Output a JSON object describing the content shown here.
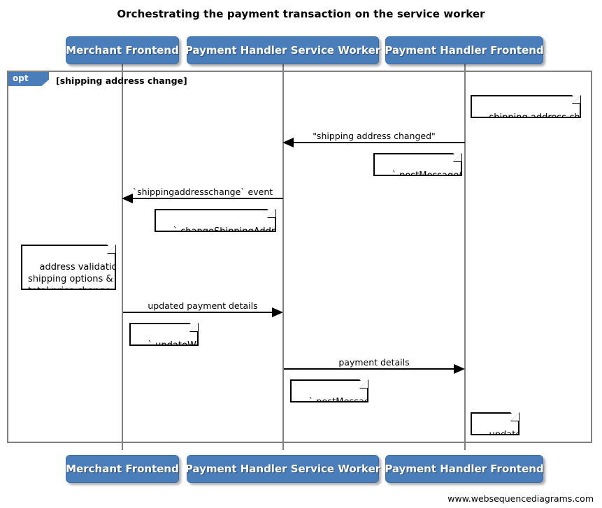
{
  "diagram": {
    "title": "Orchestrating the payment transaction on the service worker",
    "footer": "www.websequencediagrams.com",
    "colors": {
      "participant_fill": "#4a7ebb",
      "participant_text": "#ffffff",
      "lifeline": "#808080",
      "frame_border": "#808080",
      "note_border": "#000000",
      "note_fill": "#ffffff",
      "arrow": "#000000"
    }
  },
  "participants": [
    {
      "id": "merchant-frontend",
      "label": "Merchant Frontend"
    },
    {
      "id": "payment-handler-service-worker",
      "label": "Payment Handler Service Worker"
    },
    {
      "id": "payment-handler-frontend",
      "label": "Payment Handler Frontend"
    }
  ],
  "participants_bottom": [
    {
      "id": "merchant-frontend",
      "label": "Merchant Frontend"
    },
    {
      "id": "payment-handler-service-worker",
      "label": "Payment Handler Service Worker"
    },
    {
      "id": "payment-handler-frontend",
      "label": "Payment Handler Frontend"
    }
  ],
  "fragment": {
    "operator": "opt",
    "condition": "[shipping address change]"
  },
  "messages": [
    {
      "id": "shipping-address-changed",
      "label": "\"shipping address changed\"",
      "from": "payment-handler-frontend",
      "to": "payment-handler-service-worker",
      "direction": "left"
    },
    {
      "id": "shippingaddresschange-event",
      "label": "`shippingaddresschange` event",
      "from": "payment-handler-service-worker",
      "to": "merchant-frontend",
      "direction": "left"
    },
    {
      "id": "updated-payment-details",
      "label": "updated payment details",
      "from": "merchant-frontend",
      "to": "payment-handler-service-worker",
      "direction": "right"
    },
    {
      "id": "payment-details",
      "label": "payment details",
      "from": "payment-handler-service-worker",
      "to": "payment-handler-frontend",
      "direction": "right"
    }
  ],
  "notes": [
    {
      "id": "note-shipping-address-changed",
      "text": "shipping address changed",
      "over": "payment-handler-frontend"
    },
    {
      "id": "note-post-message-1",
      "text": "`.postMessage()`",
      "over": "payment-handler-frontend"
    },
    {
      "id": "note-change-shipping-address",
      "text": "`.changeShippingAddress()`",
      "over": "payment-handler-service-worker"
    },
    {
      "id": "note-address-validation",
      "text": "address validation,\nshipping options &\ntotal price change etc",
      "over": "merchant-frontend"
    },
    {
      "id": "note-update-with",
      "text": "`.updateWith()`",
      "over": "merchant-frontend"
    },
    {
      "id": "note-post-message-2",
      "text": "`.postMessage()`",
      "over": "payment-handler-service-worker"
    },
    {
      "id": "note-update-ui",
      "text": "update UI",
      "over": "payment-handler-frontend"
    }
  ]
}
